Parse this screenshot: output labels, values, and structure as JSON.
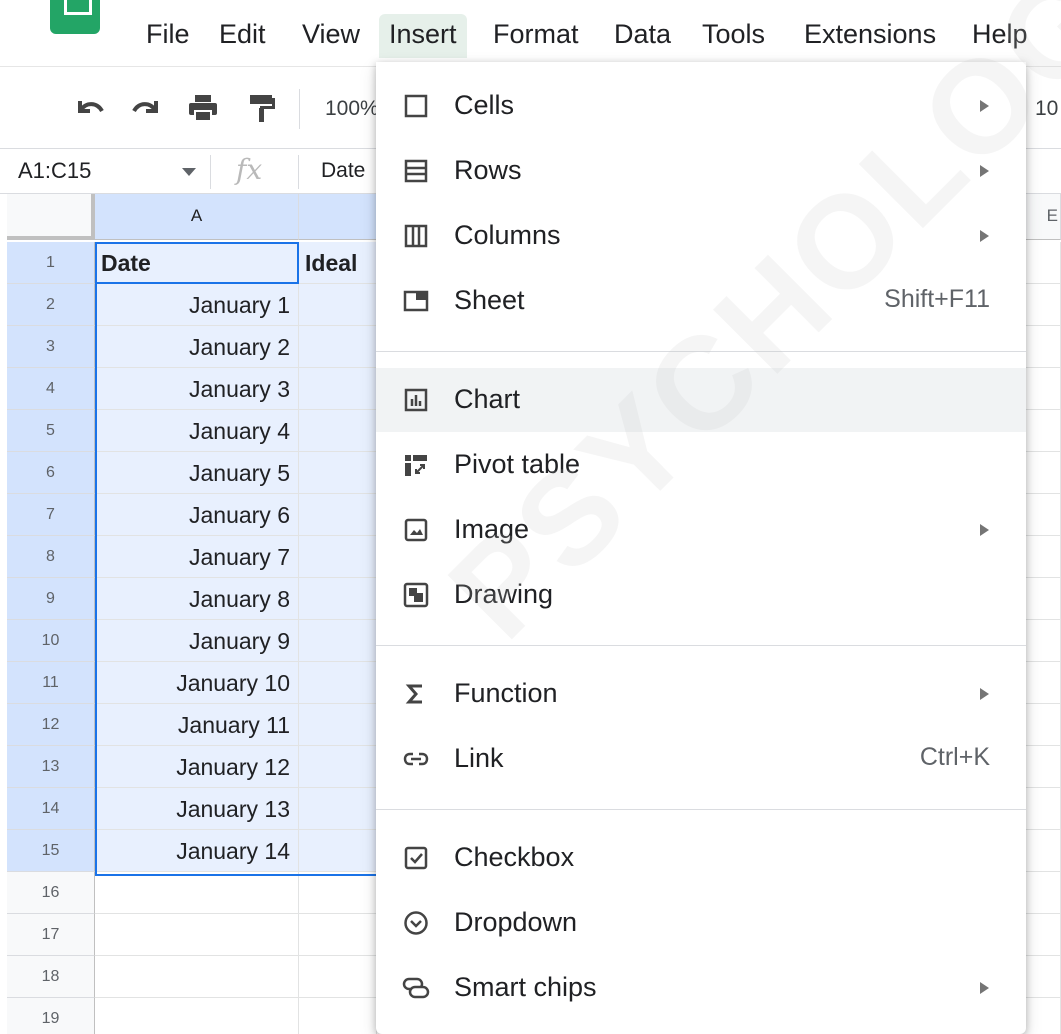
{
  "menubar": {
    "items": [
      "File",
      "Edit",
      "View",
      "Insert",
      "Format",
      "Data",
      "Tools",
      "Extensions",
      "Help"
    ],
    "active": "Insert"
  },
  "toolbar": {
    "undo_icon": "undo-icon",
    "redo_icon": "redo-icon",
    "print_icon": "print-icon",
    "paint_format_icon": "paint-format-icon",
    "zoom": "100%",
    "right_partial": "10"
  },
  "formula_bar": {
    "name_box": "A1:C15",
    "fx_label": "fx",
    "content": "Date"
  },
  "grid": {
    "columns": [
      "A",
      "",
      "",
      "",
      "",
      "",
      "E"
    ],
    "rows": [
      "1",
      "2",
      "3",
      "4",
      "5",
      "6",
      "7",
      "8",
      "9",
      "10",
      "11",
      "12",
      "13",
      "14",
      "15",
      "16",
      "17",
      "18",
      "19"
    ],
    "col_a": [
      "Date",
      "January 1",
      "January 2",
      "January 3",
      "January 4",
      "January 5",
      "January 6",
      "January 7",
      "January 8",
      "January 9",
      "January 10",
      "January 11",
      "January 12",
      "January 13",
      "January 14",
      "",
      "",
      "",
      ""
    ],
    "col_b_header": "Ideal"
  },
  "insert_menu": {
    "items": [
      {
        "label": "Cells",
        "icon": "cell-square-icon",
        "submenu": true
      },
      {
        "label": "Rows",
        "icon": "rows-icon",
        "submenu": true
      },
      {
        "label": "Columns",
        "icon": "columns-icon",
        "submenu": true
      },
      {
        "label": "Sheet",
        "icon": "sheet-icon",
        "shortcut": "Shift+F11"
      },
      {
        "label": "Chart",
        "icon": "chart-icon"
      },
      {
        "label": "Pivot table",
        "icon": "pivot-table-icon"
      },
      {
        "label": "Image",
        "icon": "image-icon",
        "submenu": true
      },
      {
        "label": "Drawing",
        "icon": "drawing-icon"
      },
      {
        "label": "Function",
        "icon": "sigma-icon",
        "submenu": true
      },
      {
        "label": "Link",
        "icon": "link-icon",
        "shortcut": "Ctrl+K"
      },
      {
        "label": "Checkbox",
        "icon": "checkbox-icon"
      },
      {
        "label": "Dropdown",
        "icon": "dropdown-icon"
      },
      {
        "label": "Smart chips",
        "icon": "smart-chips-icon",
        "submenu": true
      }
    ],
    "hovered": "Chart"
  },
  "watermark": "PSYCHOLOGY.CO",
  "colors": {
    "brand_green": "#23a566",
    "selection_blue": "#1a73e8",
    "selection_fill": "#e8f0fe",
    "menu_hover": "#f1f3f4"
  }
}
